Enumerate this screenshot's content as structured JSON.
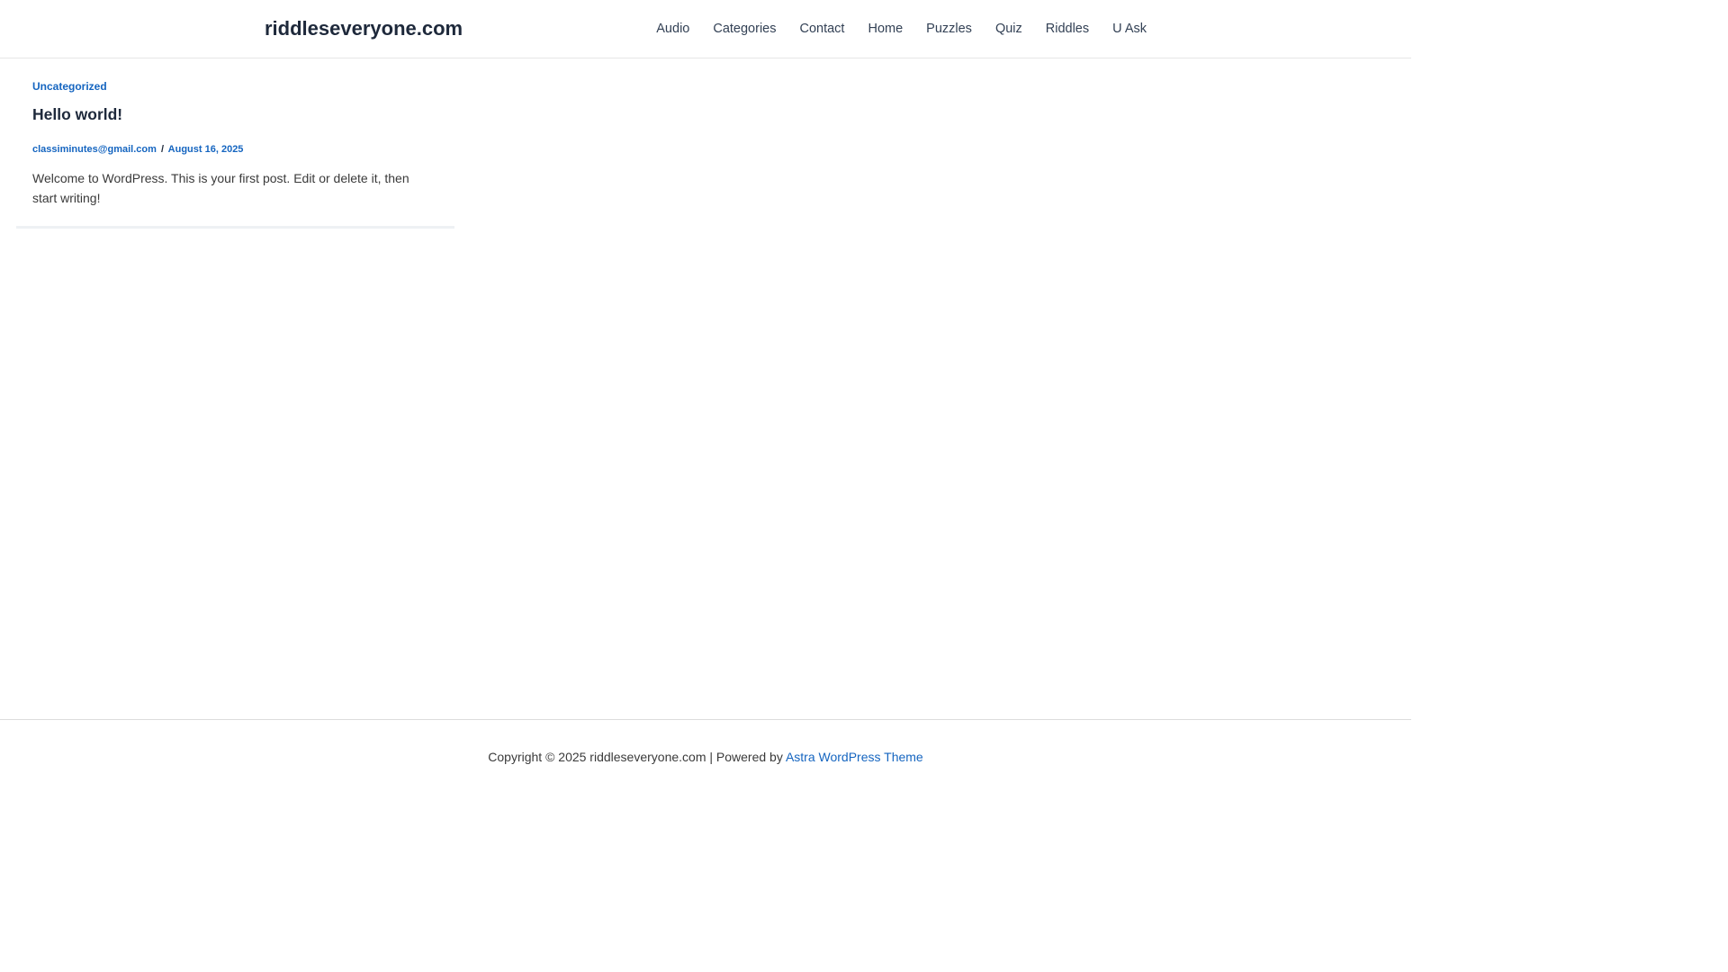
{
  "header": {
    "site_title": "riddleseveryone.com",
    "nav": [
      {
        "label": "Audio"
      },
      {
        "label": "Categories"
      },
      {
        "label": "Contact"
      },
      {
        "label": "Home"
      },
      {
        "label": "Puzzles"
      },
      {
        "label": "Quiz"
      },
      {
        "label": "Riddles"
      },
      {
        "label": "U Ask"
      }
    ]
  },
  "post": {
    "category": "Uncategorized",
    "title": "Hello world!",
    "author": "classiminutes@gmail.com",
    "separator": "/",
    "date": "August 16, 2025",
    "excerpt": "Welcome to WordPress. This is your first post. Edit or delete it, then start writing!"
  },
  "footer": {
    "copyright_text": "Copyright © 2025 riddleseveryone.com | Powered by ",
    "theme_link": "Astra WordPress Theme"
  },
  "colors": {
    "link": "#1565c0",
    "heading": "#1e293b",
    "text": "#3a3a3a"
  }
}
